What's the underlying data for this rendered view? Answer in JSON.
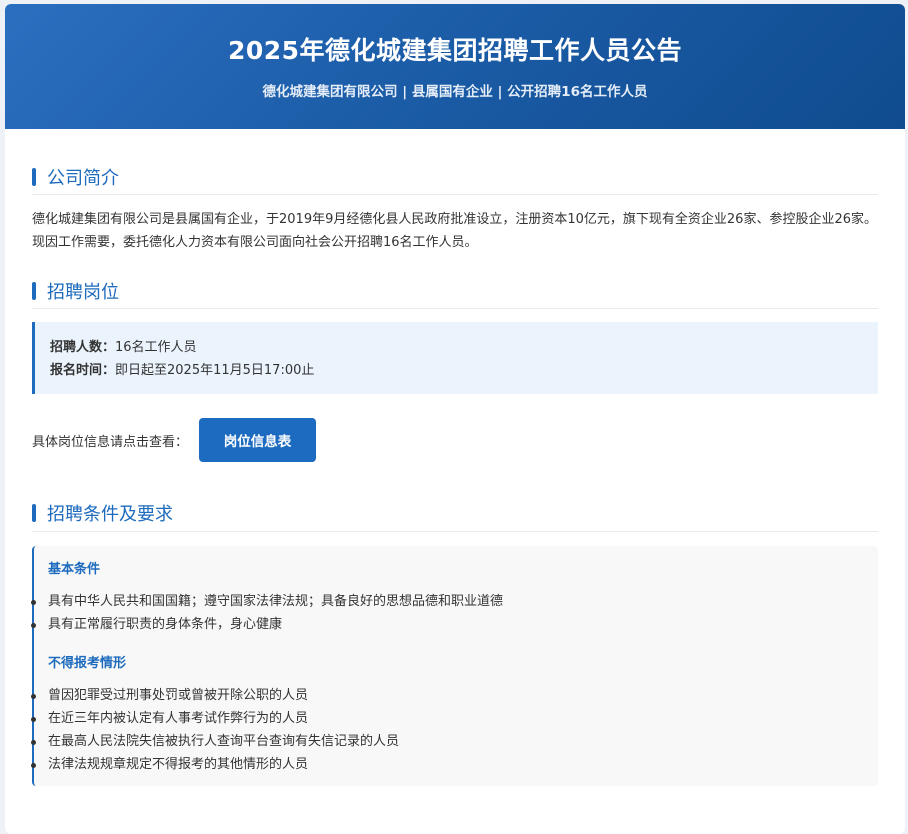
{
  "header": {
    "title": "2025年德化城建集团招聘工作人员公告",
    "subtitle": "德化城建集团有限公司 | 县属国有企业 | 公开招聘16名工作人员"
  },
  "sections": {
    "intro": {
      "title": "公司简介",
      "text": "德化城建集团有限公司是县属国有企业，于2019年9月经德化县人民政府批准设立，注册资本10亿元，旗下现有全资企业26家、参控股企业26家。现因工作需要，委托德化人力资本有限公司面向社会公开招聘16名工作人员。"
    },
    "positions": {
      "title": "招聘岗位",
      "count_label": "招聘人数：",
      "count_value": "16名工作人员",
      "time_label": "报名时间：",
      "time_value": "即日起至2025年11月5日17:00止",
      "link_prompt": "具体岗位信息请点击查看：",
      "button_label": "岗位信息表"
    },
    "requirements": {
      "title": "招聘条件及要求",
      "basic": {
        "title": "基本条件",
        "items": [
          "具有中华人民共和国国籍；遵守国家法律法规；具备良好的思想品德和职业道德",
          "具有正常履行职责的身体条件，身心健康"
        ]
      },
      "excluded": {
        "title": "不得报考情形",
        "items": [
          "曾因犯罪受过刑事处罚或曾被开除公职的人员",
          "在近三年内被认定有人事考试作弊行为的人员",
          "在最高人民法院失信被执行人查询平台查询有失信记录的人员",
          "法律法规规章规定不得报考的其他情形的人员"
        ]
      }
    }
  },
  "colors": {
    "accent": "#1e6bbd",
    "header_start": "#2b6fc0",
    "header_end": "#0f4b8e",
    "info_bg": "#ebf4fd",
    "req_bg": "#f8f8f8"
  }
}
